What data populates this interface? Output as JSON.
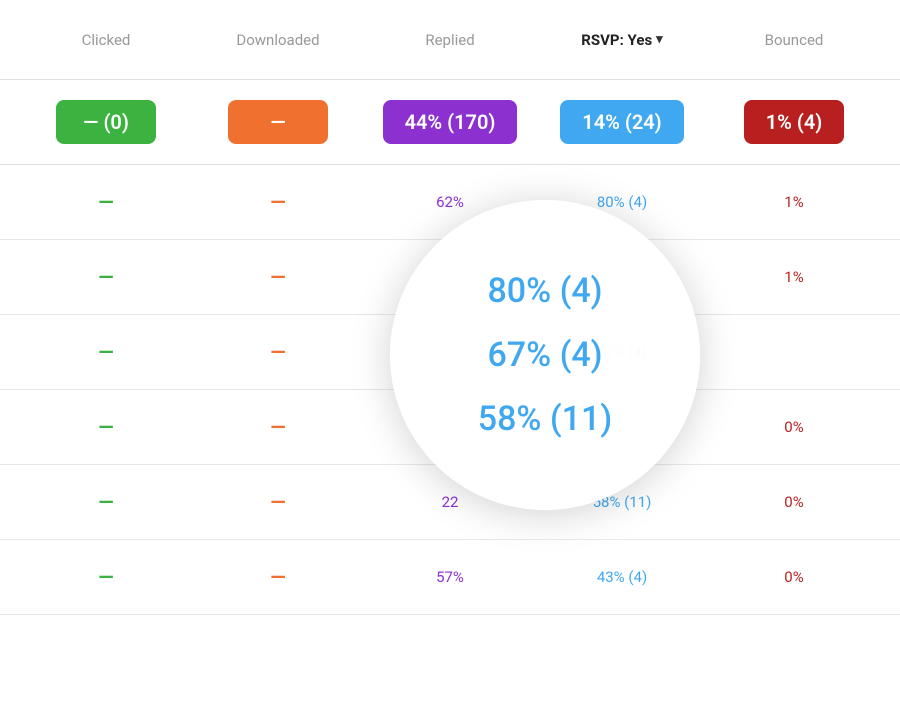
{
  "header": {
    "columns": [
      {
        "id": "clicked",
        "label": "Clicked",
        "style": "muted"
      },
      {
        "id": "downloaded",
        "label": "Downloaded",
        "style": "muted"
      },
      {
        "id": "replied",
        "label": "Replied",
        "style": "muted"
      },
      {
        "id": "rsvp",
        "label": "RSVP: Yes",
        "style": "bold",
        "hasDropdown": true
      },
      {
        "id": "bounced",
        "label": "Bounced",
        "style": "muted"
      }
    ]
  },
  "summary": {
    "clicked": {
      "label": "— (0)",
      "badge": "green"
    },
    "downloaded": {
      "label": "—",
      "badge": "orange"
    },
    "replied": {
      "label": "44% (170)",
      "badge": "purple"
    },
    "rsvp": {
      "label": "14% (24)",
      "badge": "blue"
    },
    "bounced": {
      "label": "1% (4)",
      "badge": "red"
    }
  },
  "rows": [
    {
      "clicked": {
        "type": "dash",
        "color": "green",
        "value": "—"
      },
      "downloaded": {
        "type": "dash",
        "color": "orange",
        "value": "—"
      },
      "replied": {
        "type": "pct",
        "color": "purple",
        "value": "62%"
      },
      "rsvp": {
        "type": "pct",
        "color": "blue",
        "value": "80% (4)"
      },
      "bounced": {
        "type": "pct",
        "color": "red",
        "value": "1%"
      }
    },
    {
      "clicked": {
        "type": "dash",
        "color": "green",
        "value": "—"
      },
      "downloaded": {
        "type": "dash",
        "color": "orange",
        "value": "—"
      },
      "replied": {
        "type": "pct",
        "color": "purple",
        "value": ""
      },
      "rsvp": {
        "type": "pct",
        "color": "blue",
        "value": ""
      },
      "bounced": {
        "type": "pct",
        "color": "red",
        "value": "1%"
      }
    },
    {
      "clicked": {
        "type": "dash",
        "color": "green",
        "value": "—"
      },
      "downloaded": {
        "type": "dash",
        "color": "orange",
        "value": "—"
      },
      "replied": {
        "type": "pct",
        "color": "purple",
        "value": ""
      },
      "rsvp": {
        "type": "pct",
        "color": "blue",
        "value": "67% (4)"
      },
      "bounced": {
        "type": "pct",
        "color": "red",
        "value": ""
      }
    },
    {
      "clicked": {
        "type": "dash",
        "color": "green",
        "value": "—"
      },
      "downloaded": {
        "type": "dash",
        "color": "orange",
        "value": "—"
      },
      "replied": {
        "type": "pct",
        "color": "purple",
        "value": ""
      },
      "rsvp": {
        "type": "pct",
        "color": "blue",
        "value": ""
      },
      "bounced": {
        "type": "pct",
        "color": "red",
        "value": "0%"
      }
    },
    {
      "clicked": {
        "type": "dash",
        "color": "green",
        "value": "—"
      },
      "downloaded": {
        "type": "dash",
        "color": "orange",
        "value": "—"
      },
      "replied": {
        "type": "pct",
        "color": "purple",
        "value": "22"
      },
      "rsvp": {
        "type": "pct",
        "color": "blue",
        "value": "58% (11)"
      },
      "bounced": {
        "type": "pct",
        "color": "red",
        "value": "0%"
      }
    },
    {
      "clicked": {
        "type": "dash",
        "color": "green",
        "value": "—"
      },
      "downloaded": {
        "type": "dash",
        "color": "orange",
        "value": "—"
      },
      "replied": {
        "type": "pct",
        "color": "purple",
        "value": "57%"
      },
      "rsvp": {
        "type": "pct",
        "color": "blue",
        "value": "43% (4)"
      },
      "bounced": {
        "type": "pct",
        "color": "red",
        "value": "0%"
      }
    }
  ],
  "tooltip": {
    "values": [
      "80% (4)",
      "67% (4)",
      "58% (11)"
    ]
  },
  "colors": {
    "green": "#3cb340",
    "orange": "#f07030",
    "purple": "#8c30d0",
    "blue": "#40a8f0",
    "red": "#b82020",
    "muted": "#999999",
    "bold": "#222222"
  }
}
